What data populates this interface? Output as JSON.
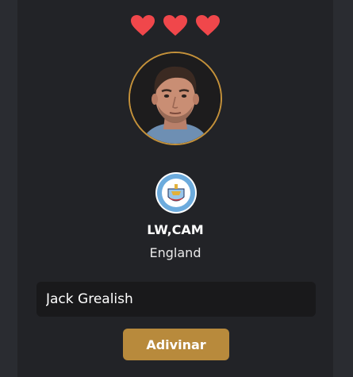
{
  "lives": {
    "count": 3,
    "icon": "heart-icon",
    "color": "#f0474b"
  },
  "player": {
    "photo_icon": "player-portrait",
    "club_crest_icon": "manchester-city-crest",
    "position": "LW,CAM",
    "nationality": "England"
  },
  "guess": {
    "value": "Jack Grealish",
    "placeholder": ""
  },
  "actions": {
    "submit_label": "Adivinar"
  },
  "colors": {
    "background": "#2a2c31",
    "card": "#222327",
    "accent": "#b88a3c",
    "ring": "#c4913a",
    "input": "#19191b"
  }
}
